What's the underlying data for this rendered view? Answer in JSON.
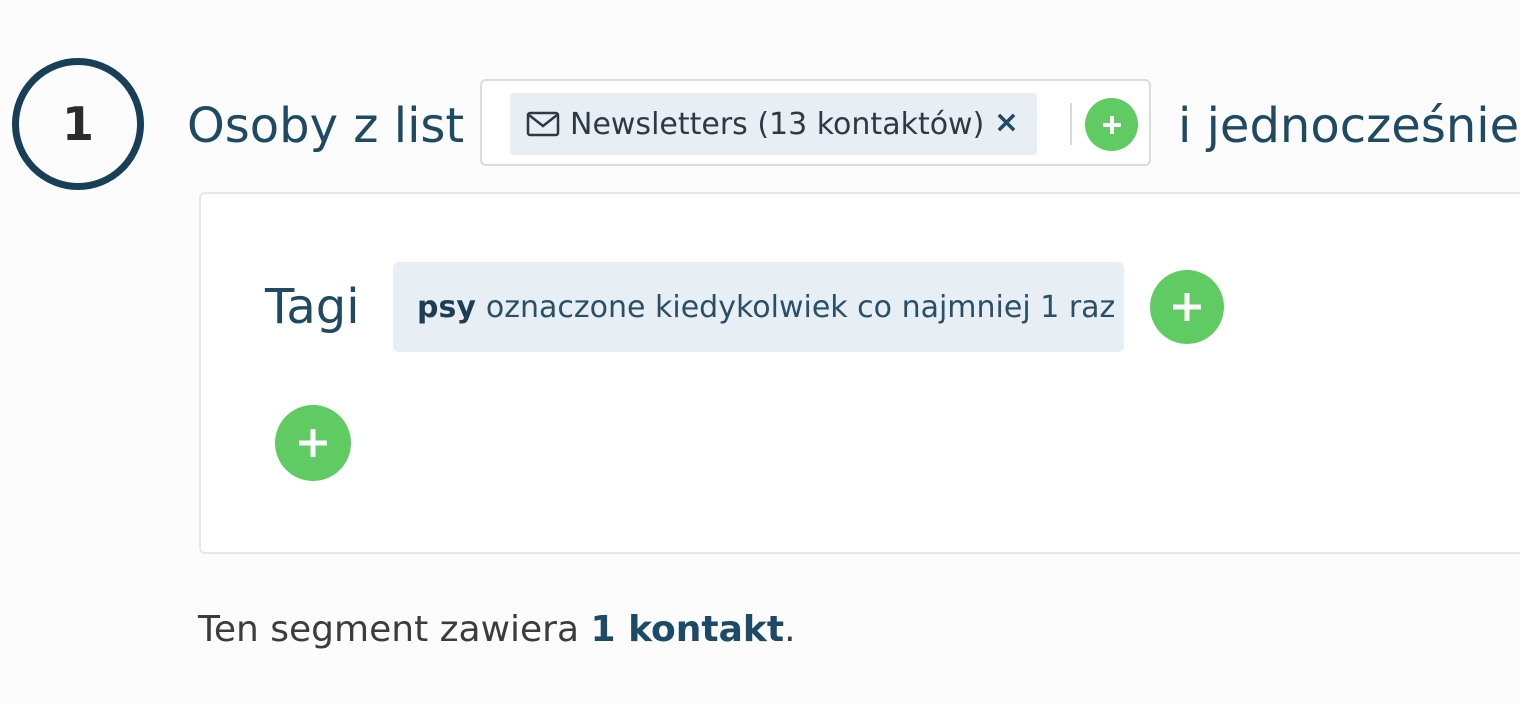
{
  "step": {
    "number": "1",
    "label": "Osoby z list",
    "trailing_label": "i jednocześnie"
  },
  "list_selector": {
    "chip": {
      "icon": "envelope-icon",
      "label": "Newsletters (13 kontaktów)",
      "remove_symbol": "×"
    },
    "add_icon": "plus-icon"
  },
  "conditions": {
    "tags_label": "Tagi",
    "tag_rule": {
      "tag": "psy",
      "description": "oznaczone kiedykolwiek co najmniej 1 raz"
    }
  },
  "summary": {
    "prefix": "Ten segment zawiera ",
    "count": "1 kontakt",
    "suffix": "."
  },
  "colors": {
    "accent": "#1e4a63",
    "add_button": "#5fcb62",
    "chip_bg": "#e7eef4"
  }
}
